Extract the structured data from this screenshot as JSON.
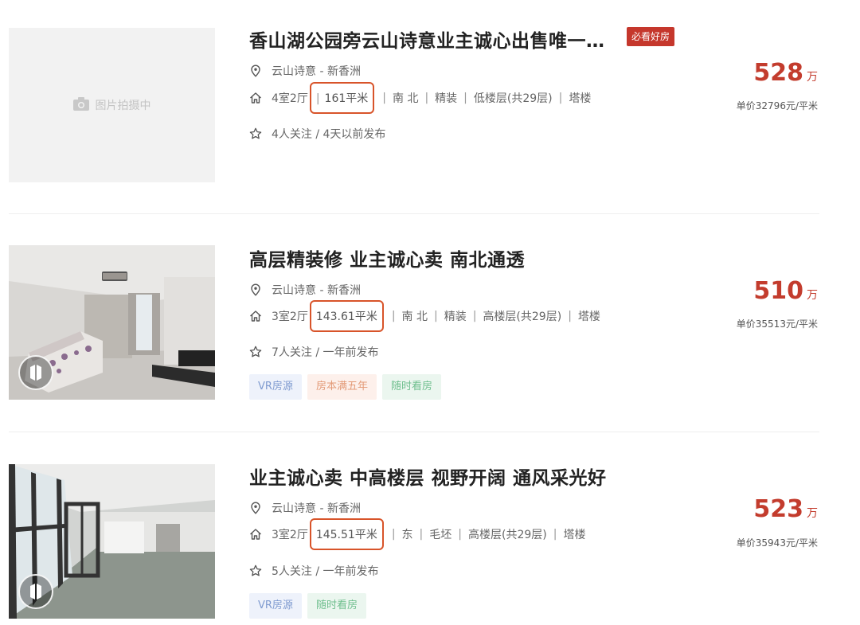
{
  "listings": [
    {
      "title": "香山湖公园旁云山诗意业主诚心出售唯一…",
      "badge": "必看好房",
      "placeholder_text": "图片拍摄中",
      "location": "云山诗意 - 新香洲",
      "layout": "4室2厅",
      "area": "161平米",
      "orientation": "南 北",
      "decoration": "精装",
      "floor": "低楼层(共29层)",
      "building": "塔楼",
      "follow": "4人关注 / 4天以前发布",
      "price": "528",
      "price_unit": "万",
      "unit_price": "单价32796元/平米",
      "tags": []
    },
    {
      "title": "高层精装修 业主诚心卖 南北通透",
      "location": "云山诗意 - 新香洲",
      "layout": "3室2厅",
      "area": "143.61平米",
      "orientation": "南 北",
      "decoration": "精装",
      "floor": "高楼层(共29层)",
      "building": "塔楼",
      "follow": "7人关注 / 一年前发布",
      "price": "510",
      "price_unit": "万",
      "unit_price": "单价35513元/平米",
      "tags": [
        "VR房源",
        "房本满五年",
        "随时看房"
      ]
    },
    {
      "title": "业主诚心卖 中高楼层 视野开阔 通风采光好",
      "location": "云山诗意 - 新香洲",
      "layout": "3室2厅",
      "area": "145.51平米",
      "orientation": "东",
      "decoration": "毛坯",
      "floor": "高楼层(共29层)",
      "building": "塔楼",
      "follow": "5人关注 / 一年前发布",
      "price": "523",
      "price_unit": "万",
      "unit_price": "单价35943元/平米",
      "tags": [
        "VR房源",
        "随时看房"
      ]
    }
  ],
  "colors": {
    "price": "#c33c2d",
    "badge_bg": "#c5372c",
    "highlight_box": "#d8542a"
  },
  "icons": {
    "location": "location-pin-icon",
    "house": "house-icon",
    "star": "star-icon",
    "camera": "camera-icon",
    "vr": "vr-icon"
  }
}
